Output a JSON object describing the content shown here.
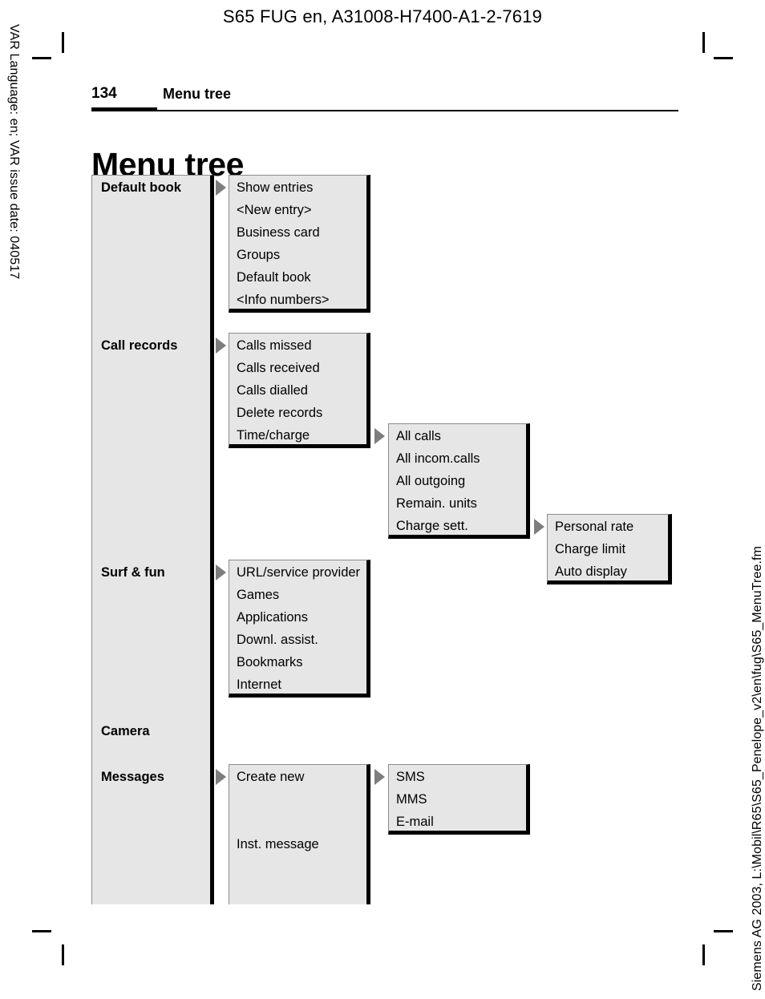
{
  "document": {
    "header": "S65 FUG en, A31008-H7400-A1-2-7619",
    "left_margin": "VAR Language: en; VAR issue date: 040517",
    "right_margin": "Siemens AG 2003, L:\\Mobil\\R65\\S65_Penelope_v2\\en\\fug\\S65_MenuTree.fm",
    "page_number": "134",
    "running_title": "Menu tree",
    "title": "Menu tree"
  },
  "colors": {
    "box_fill": "#e6e6e6",
    "box_shadow": "#000000",
    "box_hairline": "#8c8c8c",
    "arrow": "#7d7d7d",
    "text": "#000000",
    "page_background": "#ffffff"
  },
  "menu_tree": {
    "level1": [
      {
        "label": "Default book",
        "has_submenu": true
      },
      {
        "label": "Call records",
        "has_submenu": true
      },
      {
        "label": "Surf & fun",
        "has_submenu": true
      },
      {
        "label": "Camera",
        "has_submenu": false
      },
      {
        "label": "Messages",
        "has_submenu": true
      }
    ],
    "default_book": {
      "items": [
        "Show entries",
        "<New entry>",
        "Business card",
        "Groups",
        "Default book",
        "<Info numbers>"
      ]
    },
    "call_records": {
      "items": [
        "Calls missed",
        "Calls received",
        "Calls dialled",
        "Delete records",
        "Time/charge"
      ]
    },
    "time_charge": {
      "items": [
        "All calls",
        "All incom.calls",
        "All outgoing",
        "Remain. units",
        "Charge sett."
      ]
    },
    "charge_sett": {
      "items": [
        "Personal rate",
        "Charge limit",
        "Auto display"
      ]
    },
    "surf_and_fun": {
      "items": [
        "URL/service provider",
        "Games",
        "Applications",
        "Downl. assist.",
        "Bookmarks",
        "Internet"
      ]
    },
    "messages": {
      "items": [
        "Create new",
        "Inst. message"
      ]
    },
    "create_new": {
      "items": [
        "SMS",
        "MMS",
        "E-mail"
      ]
    }
  }
}
